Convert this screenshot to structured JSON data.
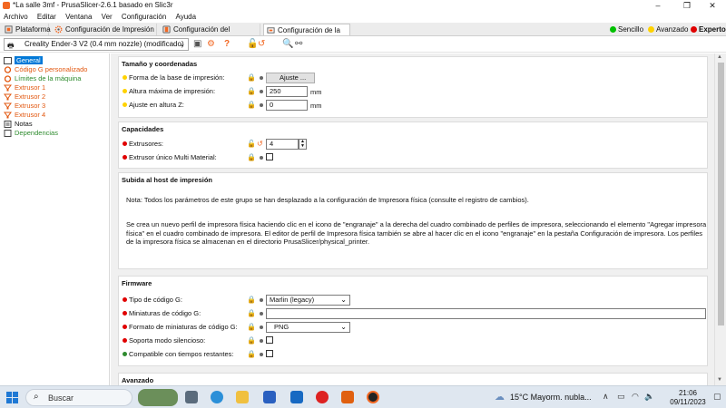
{
  "window": {
    "title": "*La salle 3mf - PrusaSlicer-2.6.1 basado en Slic3r",
    "minimize_glyph": "–",
    "restore_glyph": "❐",
    "close_glyph": "✕"
  },
  "menu": [
    "Archivo",
    "Editar",
    "Ventana",
    "Ver",
    "Configuración",
    "Ayuda"
  ],
  "tabs": [
    {
      "label": "Plataforma",
      "icon": "plater-icon"
    },
    {
      "label": "Configuración de Impresión",
      "icon": "gear-icon"
    },
    {
      "label": "Configuración del filamento",
      "icon": "spool-icon"
    },
    {
      "label": "Configuración de la Impresora",
      "icon": "printer-icon",
      "active": true
    }
  ],
  "modes": [
    {
      "label": "Sencillo",
      "color": "#00c000"
    },
    {
      "label": "Avanzado",
      "color": "#ffd200"
    },
    {
      "label": "Experto",
      "color": "#e00000",
      "active": true
    }
  ],
  "preset": {
    "selected": "Creality Ender-3 V2 (0.4 mm nozzle) (modificado)",
    "icons": [
      "save-icon",
      "delete-icon",
      "gear-icon",
      "help-icon",
      "lock-icon",
      "undo-icon",
      "search-icon",
      "compare-icon"
    ]
  },
  "sidebar": [
    {
      "label": "General",
      "color": "#111111",
      "selected": true
    },
    {
      "label": "Código G personalizado",
      "color": "#e2570f"
    },
    {
      "label": "Límites de la máquina",
      "color": "#2e8b2e"
    },
    {
      "label": "Extrusor 1",
      "color": "#e2570f"
    },
    {
      "label": "Extrusor 2",
      "color": "#e2570f"
    },
    {
      "label": "Extrusor 3",
      "color": "#e2570f"
    },
    {
      "label": "Extrusor 4",
      "color": "#e2570f"
    },
    {
      "label": "Notas",
      "color": "#111111"
    },
    {
      "label": "Dependencias",
      "color": "#2e8b2e"
    }
  ],
  "sections": {
    "size": {
      "title": "Tamaño y coordenadas",
      "bed_shape": {
        "label": "Forma de la base de impresión:",
        "button": "Ajuste ..."
      },
      "max_height": {
        "label": "Altura máxima de impresión:",
        "value": "250",
        "unit": "mm"
      },
      "z_offset": {
        "label": "Ajuste en altura Z:",
        "value": "0",
        "unit": "mm"
      }
    },
    "capabilities": {
      "title": "Capacidades",
      "extruders": {
        "label": "Extrusores:",
        "value": "4"
      },
      "single_mm": {
        "label": "Extrusor único Multi Material:"
      }
    },
    "host": {
      "title": "Subida al host de impresión",
      "note1": "Nota: Todos los parámetros de este grupo se han desplazado a la configuración de Impresora física (consulte el registro de cambios).",
      "note2": "Se crea un nuevo perfil de impresora física haciendo clic en el icono de \"engranaje\" a la derecha del cuadro combinado de perfiles de impresora, seleccionando el elemento \"Agregar impresora física\" en el cuadro combinado de impresora. El editor de perfil de Impresora física también se abre al hacer clic en el icono \"engranaje\" en la pestaña Configuración de impresora. Los perfiles de la impresora física se almacenan en el directorio PrusaSlicer/physical_printer."
    },
    "firmware": {
      "title": "Firmware",
      "gcode_flavor": {
        "label": "Tipo de código G:",
        "value": "Marlin (legacy)"
      },
      "thumbnails": {
        "label": "Miniaturas de código G:",
        "value": ""
      },
      "thumb_format": {
        "label": "Formato de miniaturas de código G:",
        "value": "PNG"
      },
      "silent": {
        "label": "Soporta modo silencioso:"
      },
      "remaining": {
        "label": "Compatible con tiempos restantes:"
      }
    },
    "advanced": {
      "title": "Avanzado"
    }
  },
  "taskbar": {
    "search_placeholder": "Buscar",
    "weather": "15°C  Mayorm. nubla...",
    "time": "21:06",
    "date": "09/11/2023"
  },
  "colors": {
    "simple": "#00c000",
    "advanced": "#ffd200",
    "expert": "#e00000",
    "accent": "#0078d7"
  }
}
